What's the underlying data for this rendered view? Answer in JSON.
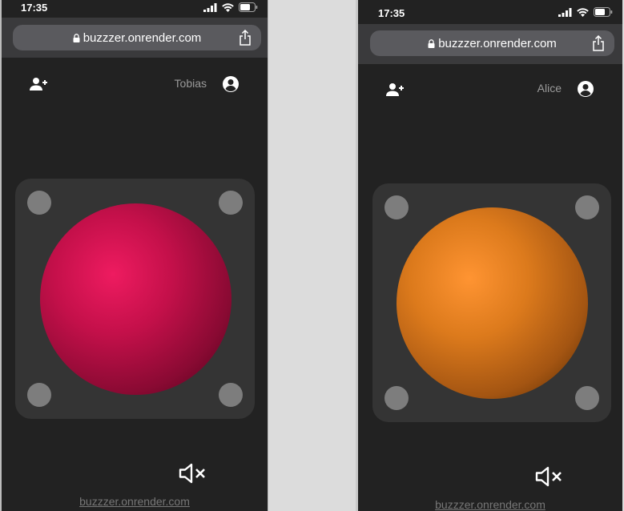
{
  "phones": [
    {
      "status": {
        "time": "17:35"
      },
      "browser": {
        "url": "buzzzer.onrender.com",
        "lock_icon": "lock-icon",
        "share_icon": "share-icon"
      },
      "appbar": {
        "username": "Tobias",
        "add_user_icon": "add-user-icon",
        "account_icon": "account-circle-icon"
      },
      "buzzer": {
        "color": "#e91e63"
      },
      "mute_icon": "volume-off-icon",
      "footer": {
        "link": "buzzzer.onrender.com"
      }
    },
    {
      "status": {
        "time": "17:35"
      },
      "browser": {
        "url": "buzzzer.onrender.com",
        "lock_icon": "lock-icon",
        "share_icon": "share-icon"
      },
      "appbar": {
        "username": "Alice",
        "add_user_icon": "add-user-icon",
        "account_icon": "account-circle-icon"
      },
      "buzzer": {
        "color": "#f28c28"
      },
      "mute_icon": "volume-off-icon",
      "footer": {
        "link": "buzzzer.onrender.com"
      }
    }
  ]
}
